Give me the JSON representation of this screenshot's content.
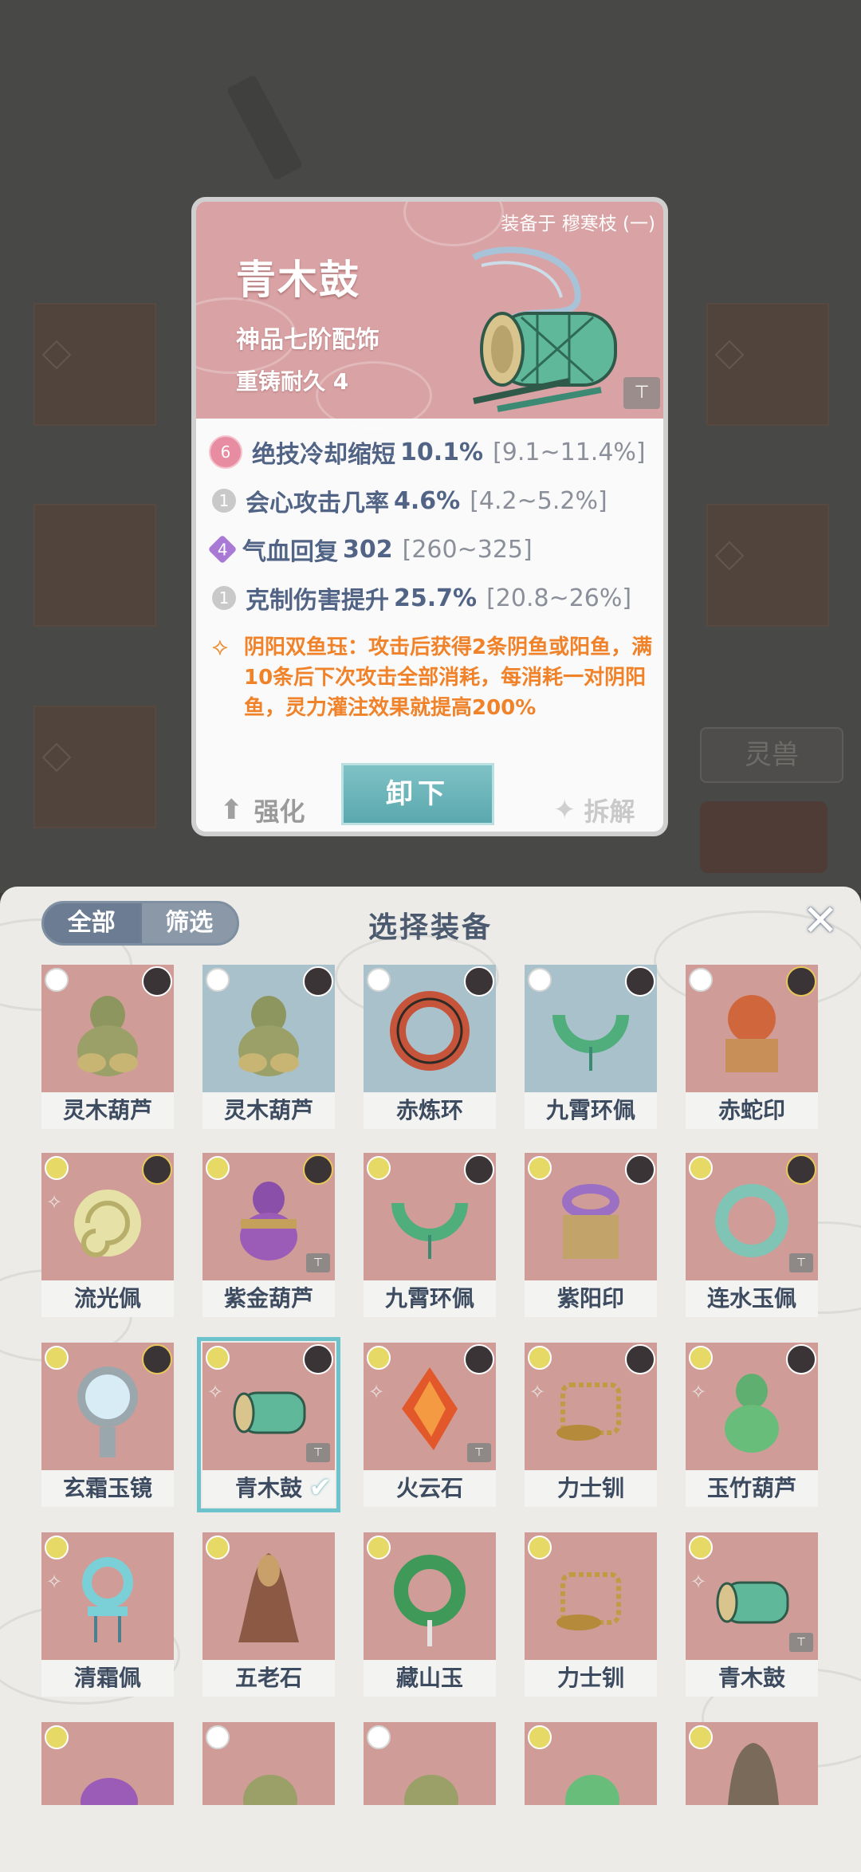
{
  "background": {
    "button_label": "灵兽"
  },
  "card": {
    "equipped_label": "装备于 穆寒枝 (一)",
    "name": "青木鼓",
    "grade": "神品七阶配饰",
    "durability": "重铸耐久 4",
    "stats": [
      {
        "tier": "6",
        "label": "绝技冷却缩短",
        "value": "10.1%",
        "range": "[9.1~11.4%]"
      },
      {
        "tier": "1",
        "label": "会心攻击几率",
        "value": "4.6%",
        "range": "[4.2~5.2%]"
      },
      {
        "tier": "4",
        "label": "气血回复",
        "value": "302",
        "range": "[260~325]"
      },
      {
        "tier": "1",
        "label": "克制伤害提升",
        "value": "25.7%",
        "range": "[20.8~26%]"
      }
    ],
    "effect_text": "阴阳双鱼珏：攻击后获得2条阴鱼或阳鱼，满10条后下次攻击全部消耗，每消耗一对阴阳鱼，灵力灌注效果就提高200%",
    "unequip_label": "卸下",
    "enhance_label": "强化",
    "dismantle_label": "拆解"
  },
  "panel": {
    "title": "选择装备",
    "tabs": [
      "全部",
      "筛选"
    ],
    "close_icon": "close-icon",
    "items": [
      {
        "name": "灵木葫芦",
        "color": "red"
      },
      {
        "name": "灵木葫芦",
        "color": "blue"
      },
      {
        "name": "赤炼环",
        "color": "blue"
      },
      {
        "name": "九霄环佩",
        "color": "blue"
      },
      {
        "name": "赤蛇印",
        "color": "red"
      },
      {
        "name": "流光佩",
        "color": "red"
      },
      {
        "name": "紫金葫芦",
        "color": "red"
      },
      {
        "name": "九霄环佩",
        "color": "red"
      },
      {
        "name": "紫阳印",
        "color": "red"
      },
      {
        "name": "连水玉佩",
        "color": "red"
      },
      {
        "name": "玄霜玉镜",
        "color": "red"
      },
      {
        "name": "青木鼓",
        "color": "red",
        "selected": true
      },
      {
        "name": "火云石",
        "color": "red"
      },
      {
        "name": "力士钏",
        "color": "red"
      },
      {
        "name": "玉竹葫芦",
        "color": "red"
      },
      {
        "name": "清霜佩",
        "color": "red"
      },
      {
        "name": "五老石",
        "color": "red"
      },
      {
        "name": "藏山玉",
        "color": "red"
      },
      {
        "name": "力士钏",
        "color": "red"
      },
      {
        "name": "青木鼓",
        "color": "red"
      }
    ]
  }
}
